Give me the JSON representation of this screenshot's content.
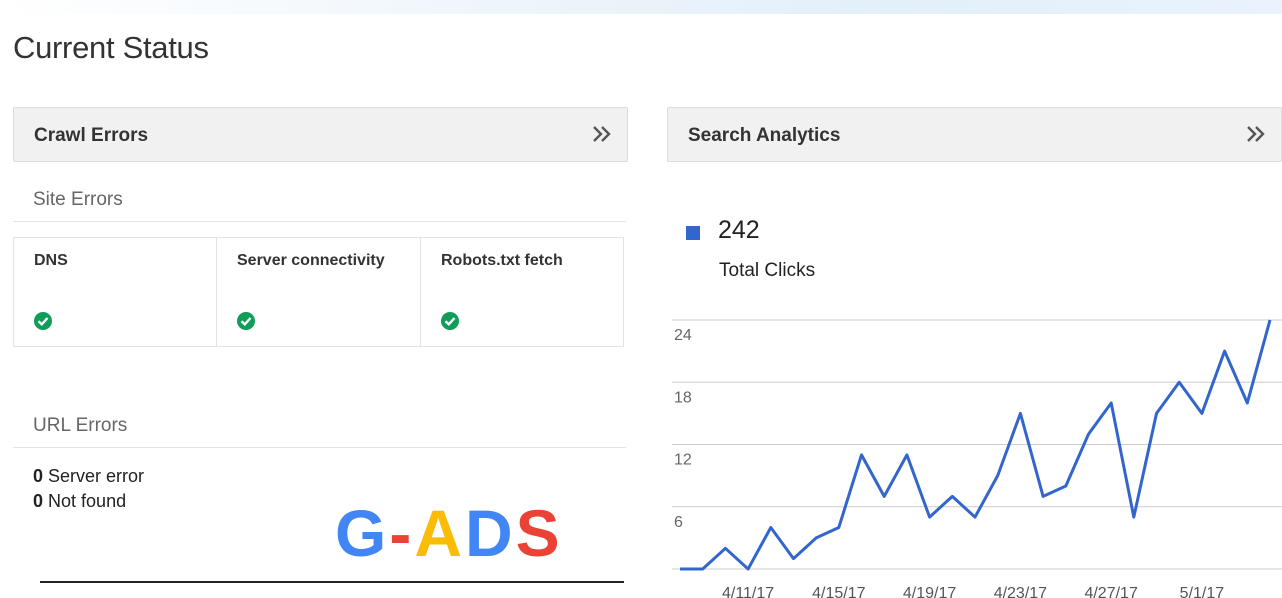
{
  "page": {
    "title": "Current Status"
  },
  "crawl_errors": {
    "title": "Crawl Errors",
    "site_errors_label": "Site Errors",
    "site_columns": [
      {
        "label": "DNS",
        "status": "ok"
      },
      {
        "label": "Server connectivity",
        "status": "ok"
      },
      {
        "label": "Robots.txt fetch",
        "status": "ok"
      }
    ],
    "url_errors_label": "URL Errors",
    "url_errors": [
      {
        "count": "0",
        "label": "Server error"
      },
      {
        "count": "0",
        "label": "Not found"
      }
    ]
  },
  "search_analytics": {
    "title": "Search Analytics",
    "total_value": "242",
    "total_label": "Total Clicks"
  },
  "watermark": {
    "letters": [
      {
        "char": "G",
        "color": "#4285f4"
      },
      {
        "char": "-",
        "color": "#ea4335"
      },
      {
        "char": "A",
        "color": "#fbbc05"
      },
      {
        "char": "D",
        "color": "#4285f4"
      },
      {
        "char": "S",
        "color": "#ea4335"
      }
    ]
  },
  "colors": {
    "series": "#3366cc",
    "ok": "#0f9d58",
    "header_bg": "#f1f1f1"
  },
  "chart_data": {
    "type": "line",
    "series": [
      {
        "name": "Total Clicks",
        "values": [
          0,
          0,
          2,
          0,
          4,
          1,
          3,
          4,
          11,
          7,
          11,
          5,
          7,
          5,
          9,
          15,
          7,
          8,
          13,
          16,
          5,
          15,
          18,
          15,
          21,
          16,
          24
        ]
      }
    ],
    "x_tick_labels": [
      "4/11/17",
      "4/15/17",
      "4/19/17",
      "4/23/17",
      "4/27/17",
      "5/1/17"
    ],
    "y_ticks": [
      6,
      12,
      18,
      24
    ],
    "ylim": [
      0,
      24
    ]
  }
}
